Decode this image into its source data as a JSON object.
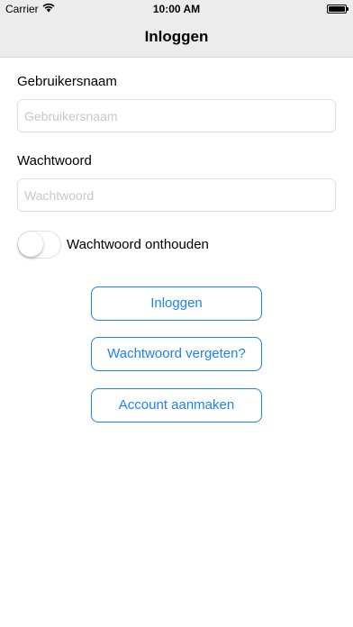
{
  "status_bar": {
    "carrier": "Carrier",
    "time": "10:00 AM",
    "icons": [
      "wifi-icon",
      "battery-icon"
    ]
  },
  "nav": {
    "title": "Inloggen"
  },
  "form": {
    "username": {
      "label": "Gebruikersnaam",
      "placeholder": "Gebruikersnaam",
      "value": ""
    },
    "password": {
      "label": "Wachtwoord",
      "placeholder": "Wachtwoord",
      "value": ""
    },
    "remember": {
      "label": "Wachtwoord onthouden",
      "on": false
    }
  },
  "buttons": {
    "login": "Inloggen",
    "forgot": "Wachtwoord vergeten?",
    "create": "Account aanmaken"
  },
  "colors": {
    "accent": "#1a82fb",
    "bar_background": "#ececec"
  }
}
